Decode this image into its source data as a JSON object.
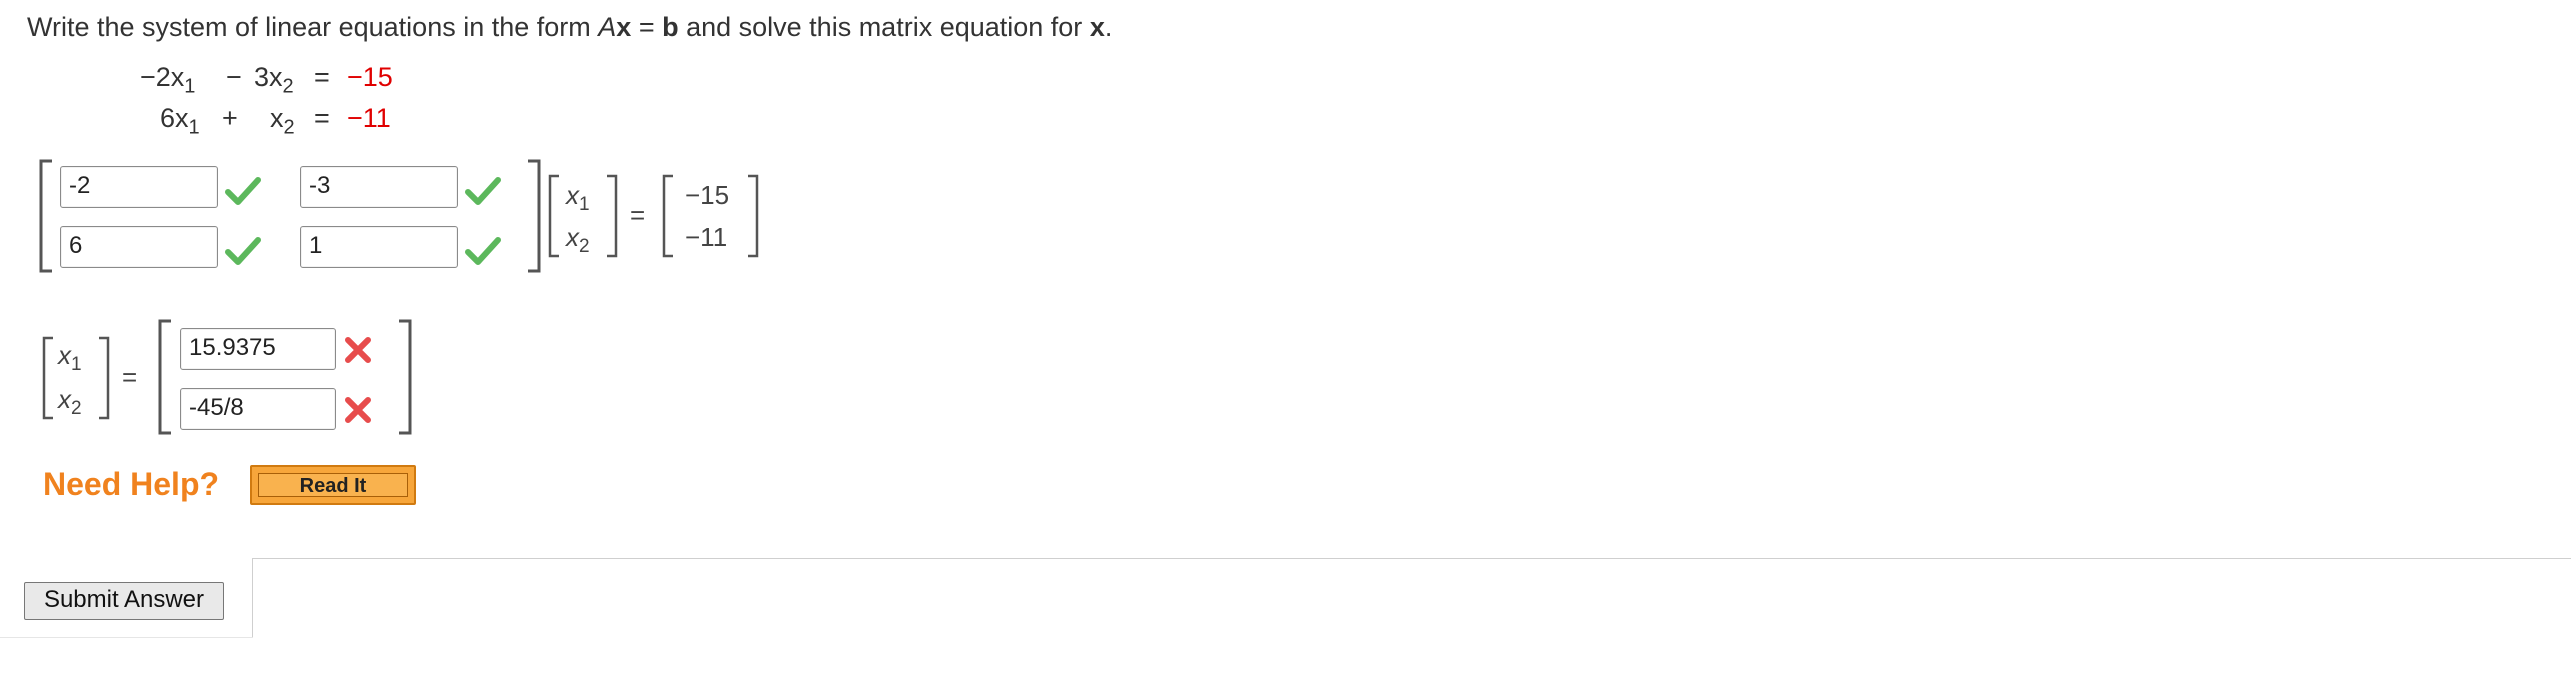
{
  "question": {
    "prefix": "Write the system of linear equations in the form ",
    "A": "A",
    "x": "x",
    "equals": " = ",
    "b": "b",
    "middle": " and solve this matrix equation for ",
    "x2": "x",
    "period": "."
  },
  "system": {
    "eq1": {
      "coef1": "−2x",
      "sub1": "1",
      "op": "−",
      "coef2": "3x",
      "sub2": "2",
      "eq": "=",
      "rhs": "−15"
    },
    "eq2": {
      "coef1": "6x",
      "sub1": "1",
      "op": "+",
      "coef2": "x",
      "sub2": "2",
      "eq": "=",
      "rhs": "−11"
    }
  },
  "matrix_A": {
    "a11": "-2",
    "a12": "-3",
    "a21": "6",
    "a22": "1",
    "status": [
      "correct",
      "correct",
      "correct",
      "correct"
    ]
  },
  "vector_x": {
    "x1": "x",
    "sub1": "1",
    "x2": "x",
    "sub2": "2",
    "equals": "="
  },
  "vector_b": {
    "b1": "−15",
    "b2": "−11"
  },
  "solution": {
    "x1_value": "15.9375",
    "x2_value": "-45/8",
    "status": [
      "incorrect",
      "incorrect"
    ],
    "equals": "="
  },
  "help": {
    "label": "Need Help?",
    "read_it": "Read It"
  },
  "submit": {
    "label": "Submit Answer"
  },
  "colors": {
    "red": "#e00000",
    "check_green": "#5cb85c",
    "cross_red": "#e74c4c",
    "help_orange": "#f0821e",
    "button_orange": "#f7a63b"
  },
  "icons": [
    "checkmark-icon",
    "cross-icon"
  ]
}
